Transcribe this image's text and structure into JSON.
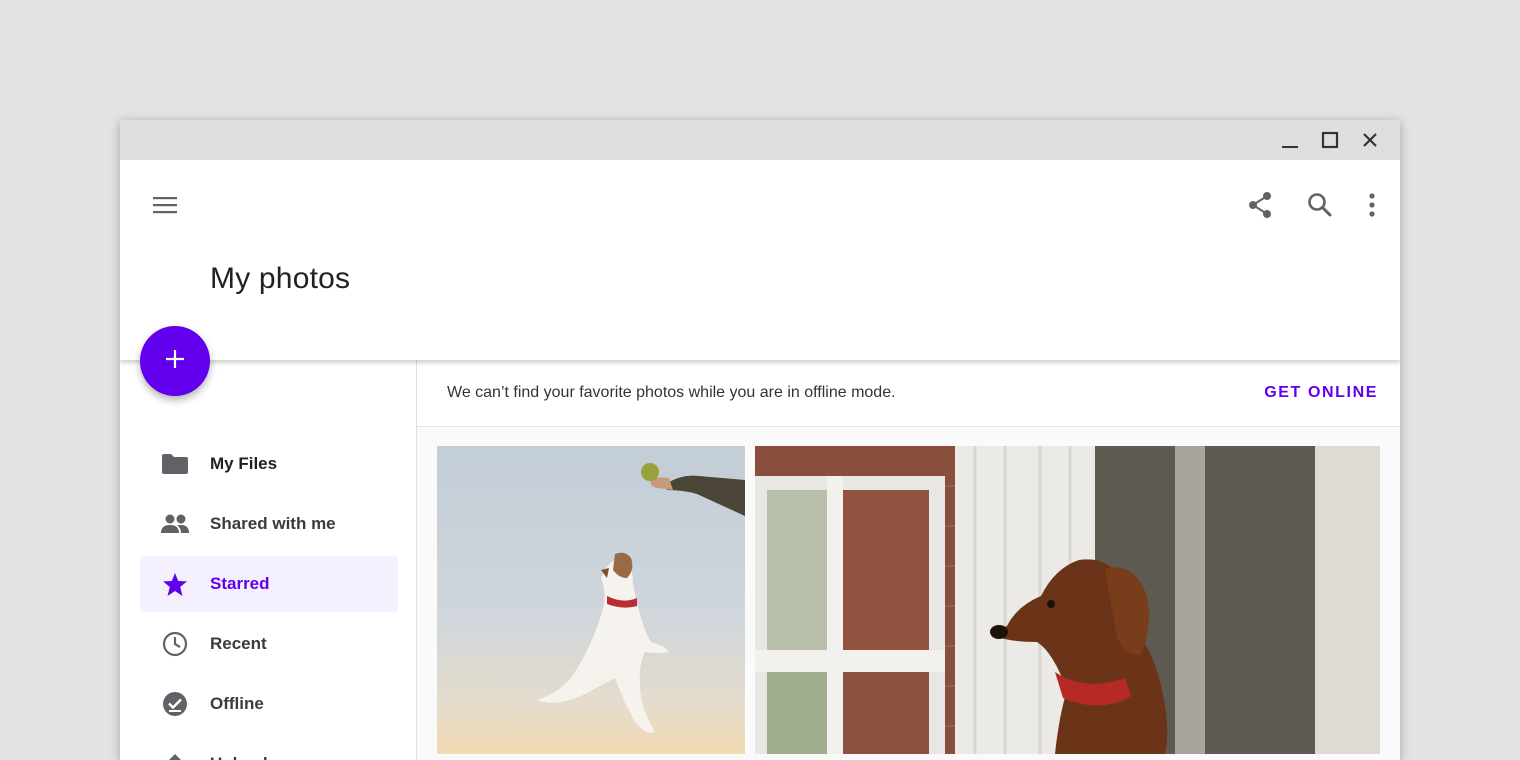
{
  "window": {
    "controls": [
      "minimize-icon",
      "maximize-icon",
      "close-icon"
    ]
  },
  "appbar": {
    "title": "My photos",
    "menu_icon": "menu-icon",
    "actions": [
      "share-icon",
      "search-icon",
      "more-vert-icon"
    ]
  },
  "fab": {
    "icon": "plus-icon",
    "color": "#6200ee"
  },
  "sidebar": {
    "items": [
      {
        "label": "My Files",
        "icon": "folder-icon"
      },
      {
        "label": "Shared with me",
        "icon": "people-icon"
      },
      {
        "label": "Starred",
        "icon": "star-icon",
        "active": true
      },
      {
        "label": "Recent",
        "icon": "clock-icon"
      },
      {
        "label": "Offline",
        "icon": "offline-check-icon"
      },
      {
        "label": "Upload",
        "icon": "upload-icon"
      }
    ]
  },
  "banner": {
    "message": "We can’t find your favorite photos while you are in offline mode.",
    "action": "GET ONLINE"
  },
  "photos": [
    {
      "subject": "dog jumping for tennis ball"
    },
    {
      "subject": "dachshund looking out window"
    }
  ],
  "colors": {
    "accent": "#6200ee",
    "active_bg": "#f5f0fd",
    "titlebar": "#dedede",
    "backdrop": "#e3e3e3"
  }
}
